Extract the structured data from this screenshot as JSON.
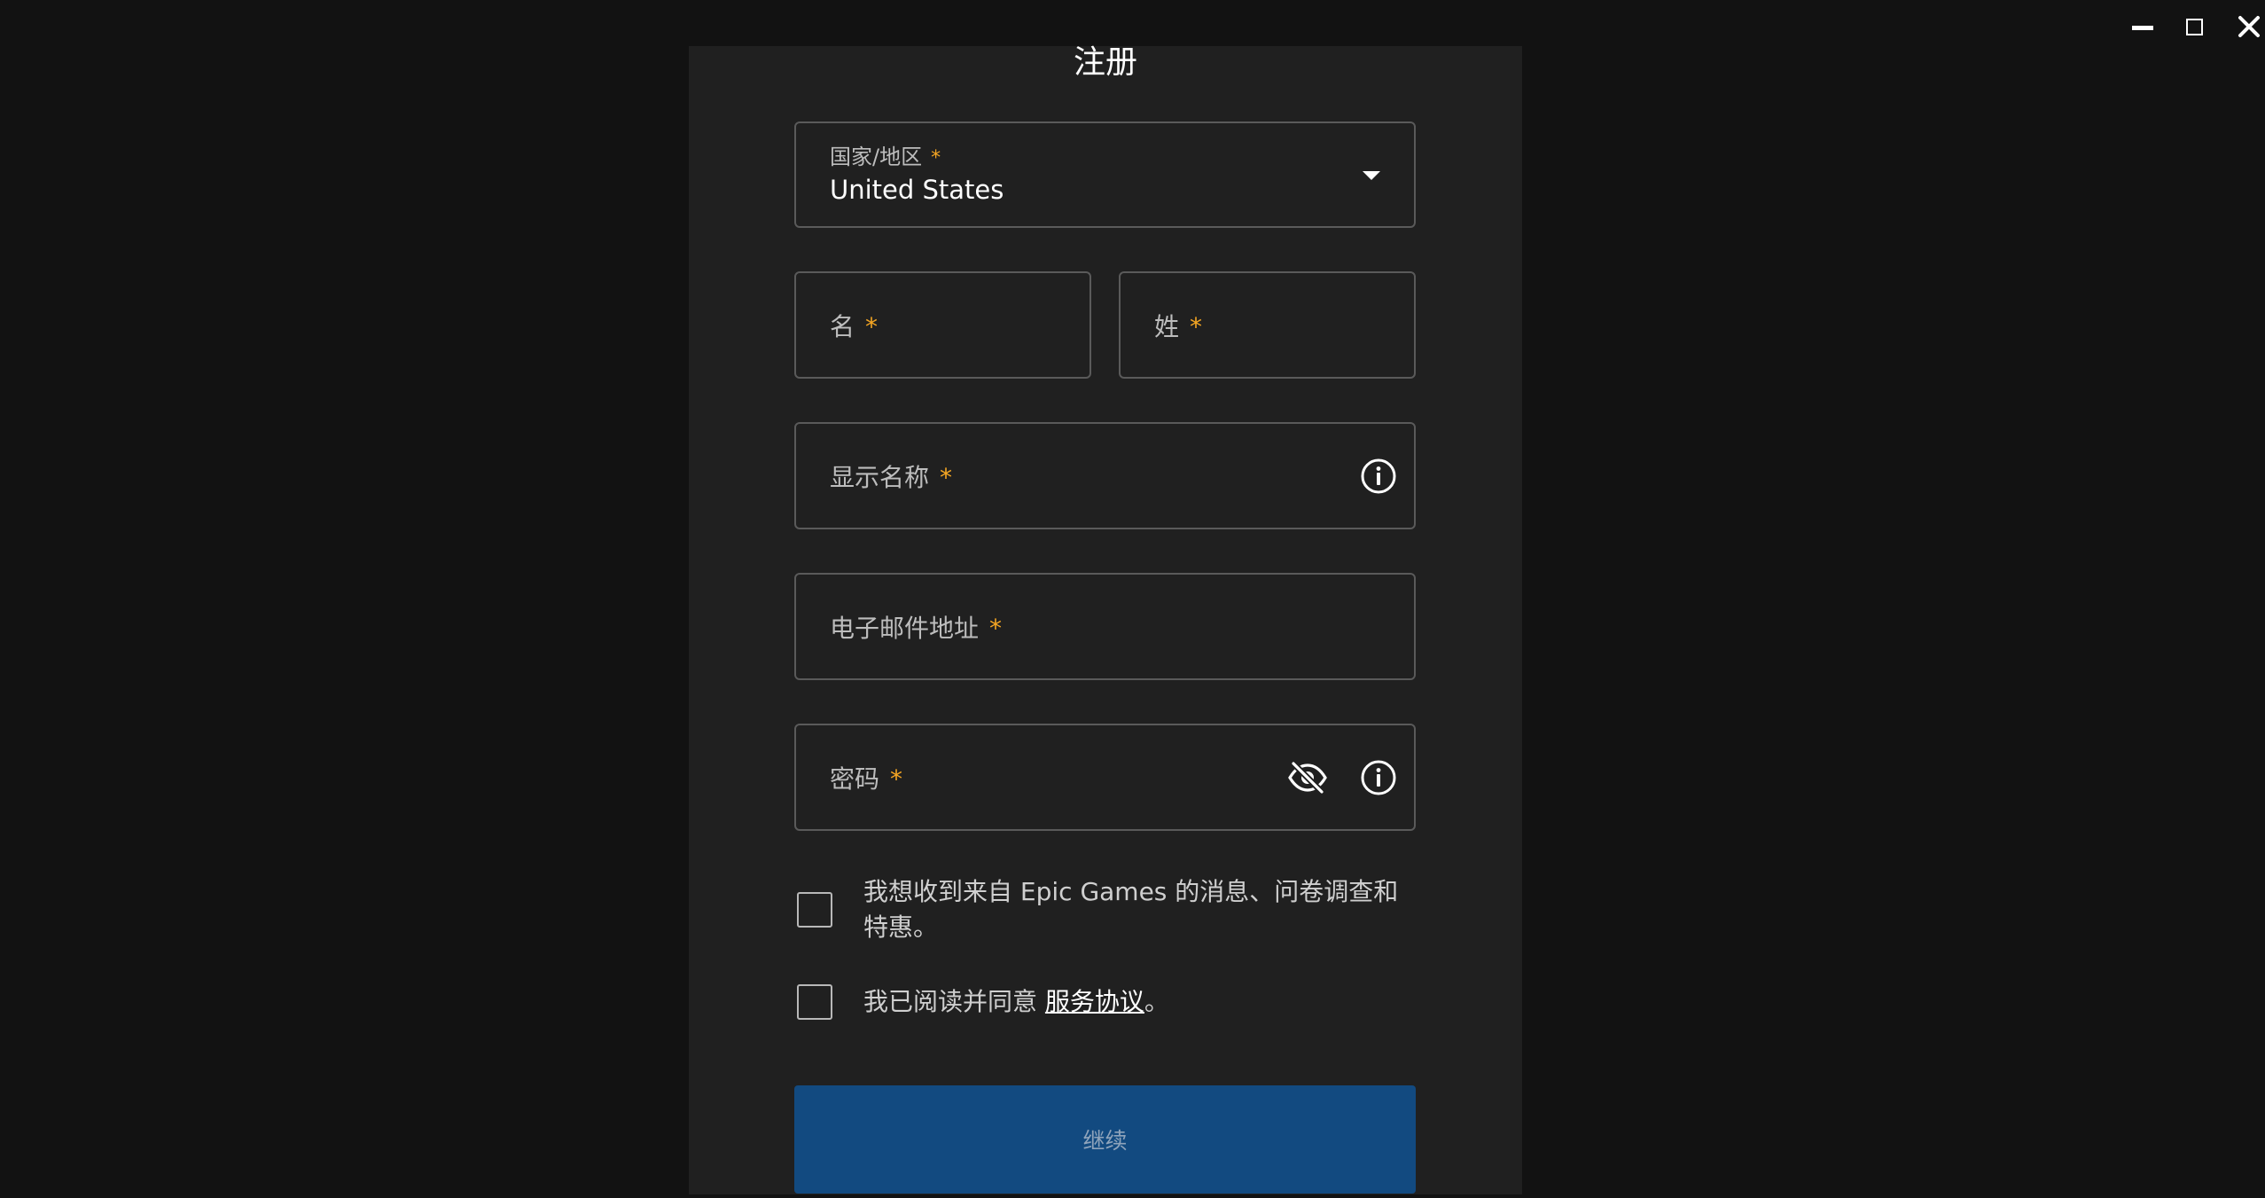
{
  "window": {
    "minimize_icon": "minimize-icon",
    "maximize_icon": "maximize-icon",
    "close_icon": "close-icon"
  },
  "form": {
    "title": "注册",
    "country": {
      "label": "国家/地区",
      "required_mark": "*",
      "value": "United States",
      "icon": "chevron-down-icon"
    },
    "first_name": {
      "label": "名",
      "required_mark": "*"
    },
    "last_name": {
      "label": "姓",
      "required_mark": "*"
    },
    "display_name": {
      "label": "显示名称",
      "required_mark": "*",
      "icon": "info-icon"
    },
    "email": {
      "label": "电子邮件地址",
      "required_mark": "*"
    },
    "password": {
      "label": "密码",
      "required_mark": "*",
      "icons": [
        "eye-off-icon",
        "info-icon"
      ]
    },
    "marketing_checkbox": {
      "checked": false,
      "text": "我想收到来自 Epic Games 的消息、问卷调查和特惠。"
    },
    "terms_checkbox": {
      "checked": false,
      "text_before": "我已阅读并同意 ",
      "link_text": "服务协议",
      "text_after": "。"
    },
    "continue_label": "继续"
  },
  "colors": {
    "background": "#121212",
    "panel": "#202020",
    "field_border": "#5a5a5a",
    "required": "#f5a623",
    "button": "#124a80",
    "button_text": "#8fa4bb"
  }
}
